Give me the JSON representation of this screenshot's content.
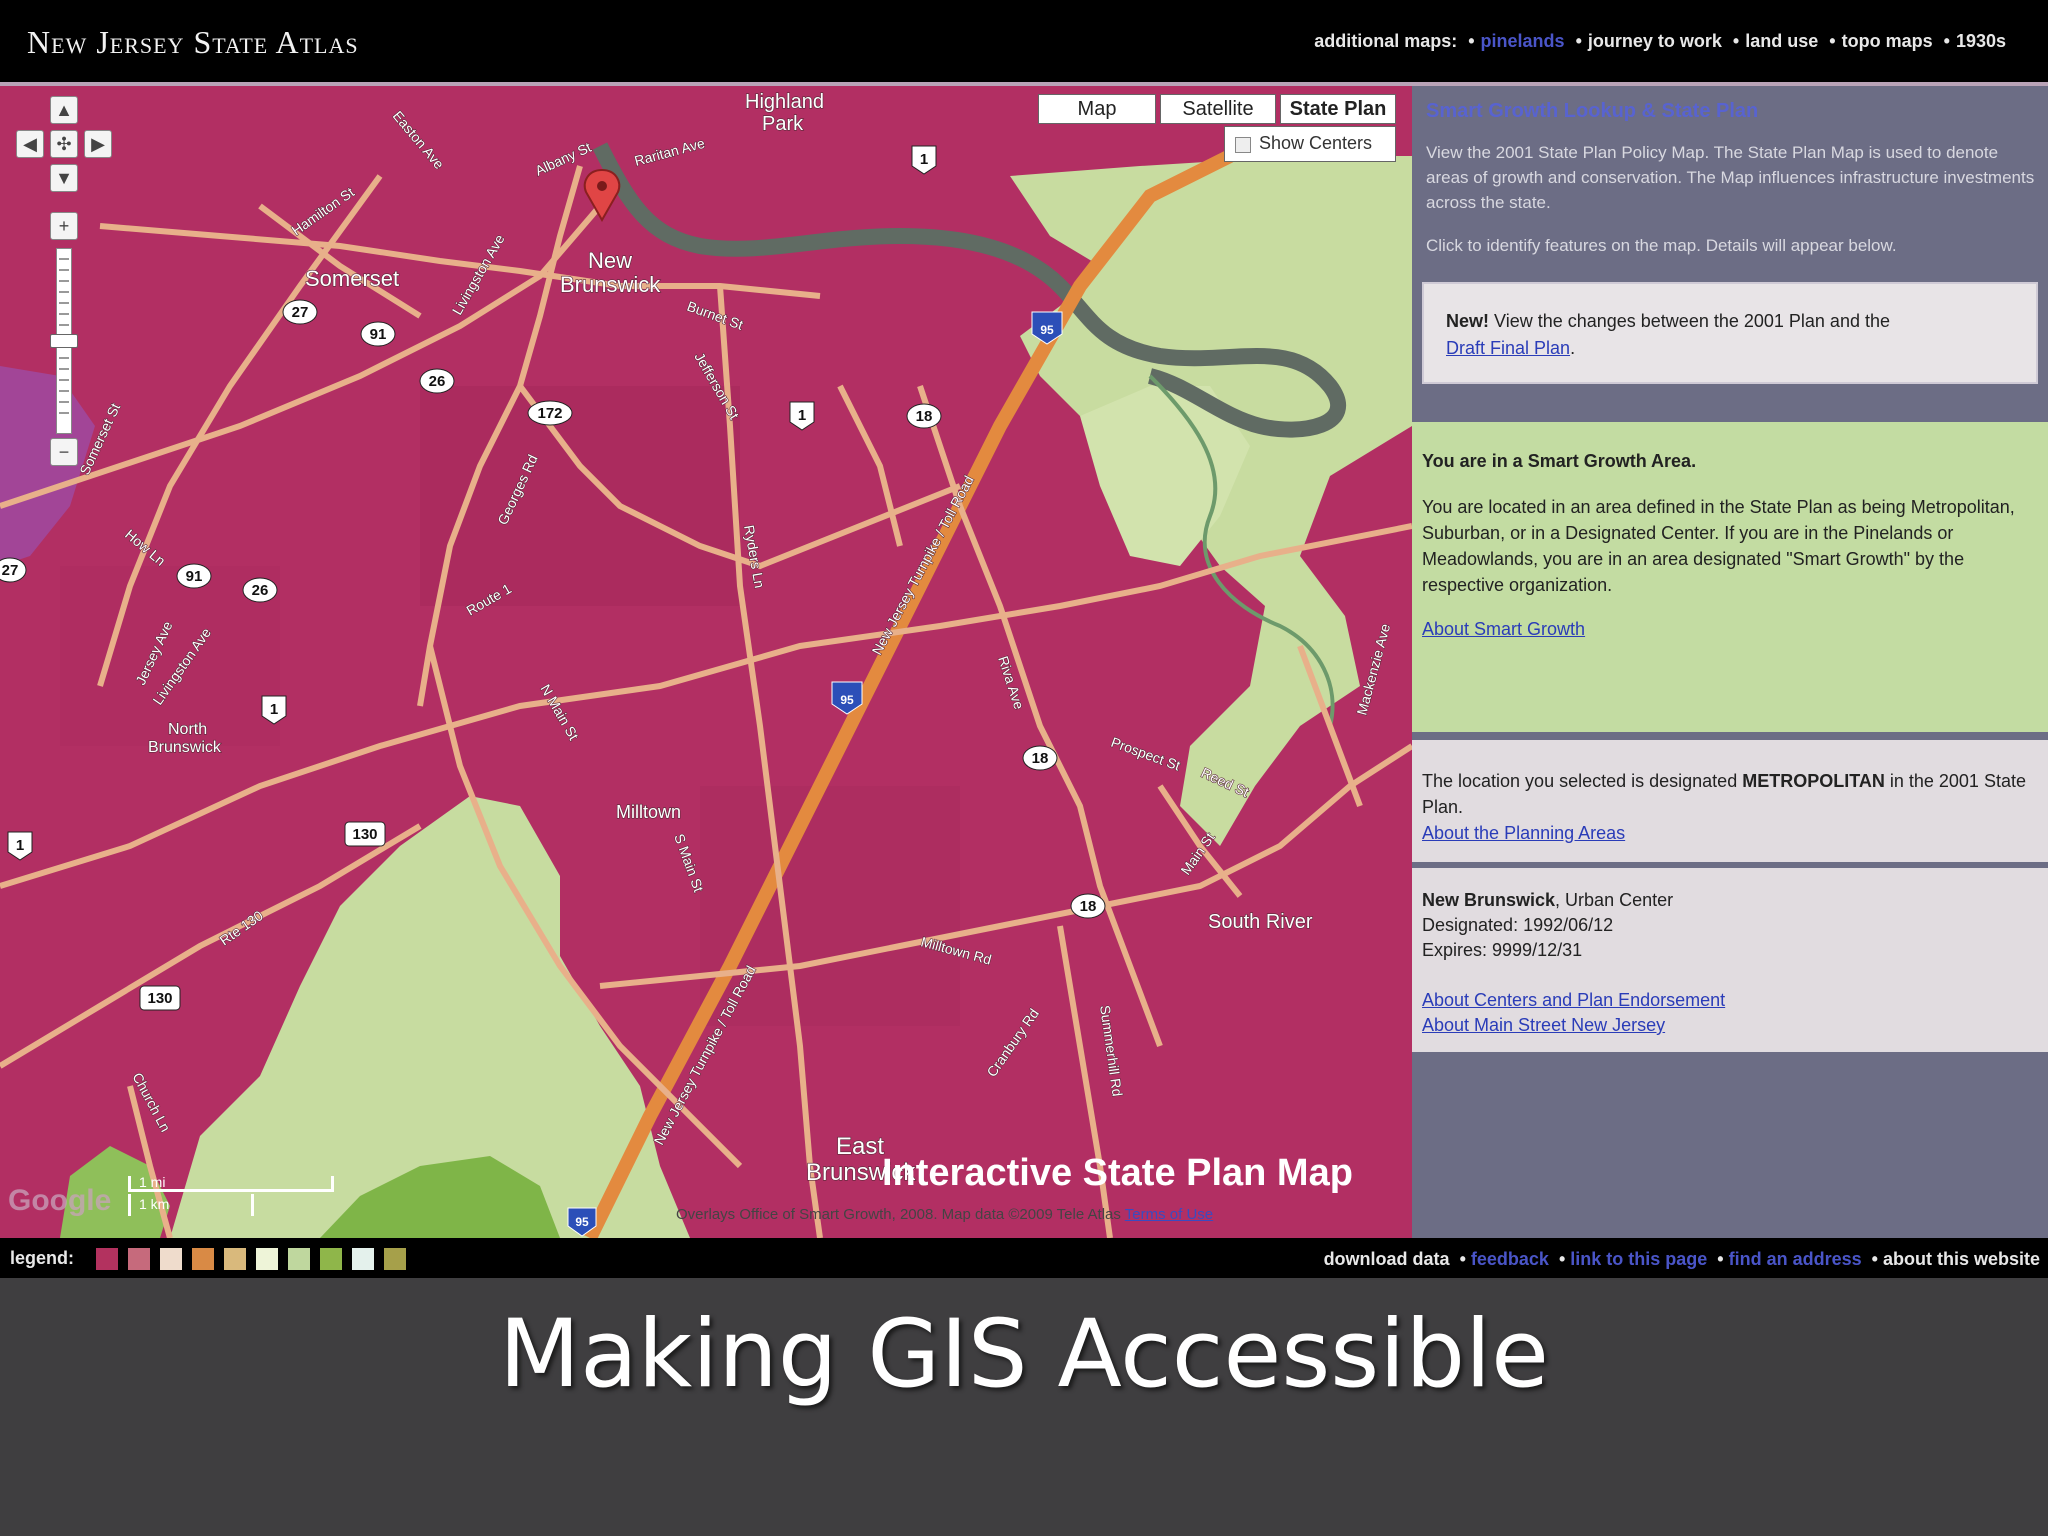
{
  "header": {
    "site_title": "New Jersey State Atlas",
    "additional_maps_label": "additional maps:",
    "links": [
      "pinelands",
      "journey to work",
      "land use",
      "topo maps",
      "1930s"
    ]
  },
  "map": {
    "map_types": [
      "Map",
      "Satellite",
      "State Plan"
    ],
    "show_centers": "Show Centers",
    "places": [
      "Highland Park",
      "New Brunswick",
      "Somerset",
      "North Brunswick",
      "Milltown",
      "South River",
      "East Brunswick"
    ],
    "streets": [
      "Easton Ave",
      "Albany St",
      "Raritan Ave",
      "Hamilton St",
      "Livingston Ave",
      "Somerset St",
      "Burnet St",
      "Jersey Ave",
      "How Ln",
      "Route 1",
      "Georges Rd",
      "Ryders Ln",
      "N Main St",
      "S Main St",
      "New Jersey Turnpike / Toll Road",
      "Riva Ave",
      "Prospect St",
      "Reed St",
      "Main St",
      "Milltown Rd",
      "Cranbury Rd",
      "Summerhill Rd",
      "Rte 130",
      "Church Ln",
      "Mackenzie Ave"
    ],
    "shields": [
      "27",
      "91",
      "26",
      "172",
      "1",
      "18",
      "95",
      "130"
    ],
    "watermark": "Interactive State Plan Map",
    "attribution": "Overlays Office of Smart Growth, 2008. Map data ©2009 Tele Atlas",
    "terms": "Terms of Use",
    "scale_mi": "1 mi",
    "scale_km": "1 km",
    "google_logo": "Google"
  },
  "sidebar": {
    "title": "Smart Growth Lookup & State Plan",
    "intro": "View the 2001 State Plan Policy Map. The State Plan Map is used to denote areas of growth and conservation. The Map influences infrastructure investments across the state.",
    "click_hint": "Click to identify features on the map. Details will appear below.",
    "new_bold": "New!",
    "new_text": " View the changes between the 2001 Plan and the ",
    "new_link": "Draft Final Plan",
    "new_end": ".",
    "smart_heading": "You are in a Smart Growth Area.",
    "smart_text": "You are located in an area defined in the State Plan as being Metropolitan, Suburban, or in a Designated Center. If you are in the Pinelands or Meadowlands, you are in an area designated \"Smart Growth\" by the respective organization.",
    "smart_link": "About Smart Growth",
    "metro_pre": "The location you selected is designated ",
    "metro_bold": "METROPOLITAN",
    "metro_post": " in the 2001 State Plan.",
    "metro_link": "About the Planning Areas",
    "center_name": "New Brunswick",
    "center_type": ", Urban Center",
    "designated": "Designated: 1992/06/12",
    "expires": "Expires: 9999/12/31",
    "link_centers": "About Centers and Plan Endorsement",
    "link_mainstreet": "About Main Street New Jersey"
  },
  "footer": {
    "legend_label": "legend:",
    "legend_colors": [
      "#b3325f",
      "#c66a7c",
      "#efdccc",
      "#d98a45",
      "#d9b97c",
      "#eef4d8",
      "#bfd79e",
      "#8fb64a",
      "#e4f1ec",
      "#a6a04a"
    ],
    "links": [
      "download data",
      "feedback",
      "link to this page",
      "find an address",
      "about this website"
    ]
  },
  "caption": "Making GIS Accessible"
}
